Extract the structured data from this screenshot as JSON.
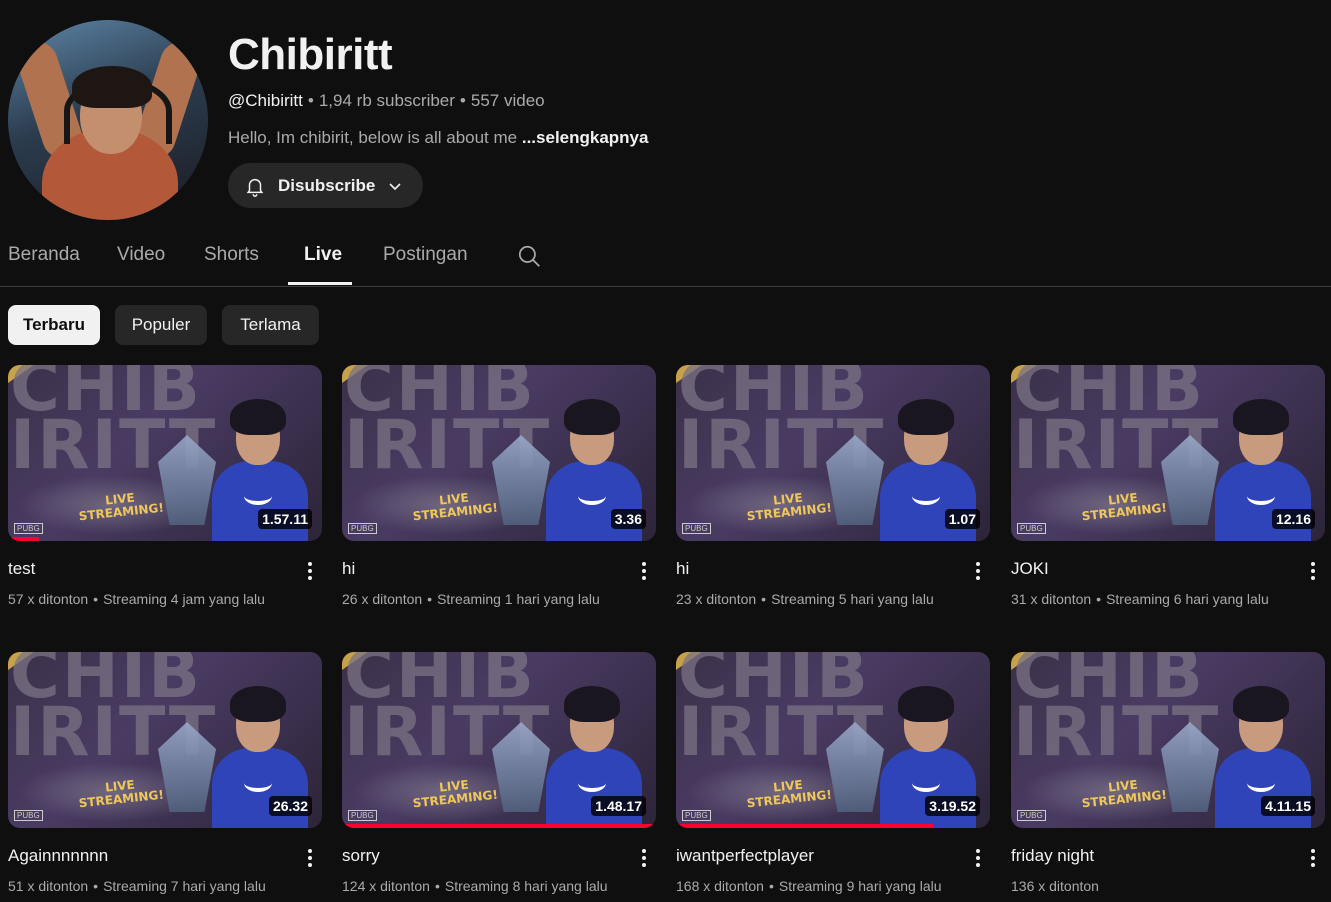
{
  "channel": {
    "name": "Chibiritt",
    "handle": "@Chibiritt",
    "subscribers": "1,94 rb subscriber",
    "video_count": "557 video",
    "description": "Hello, Im chibirit, below is all about me",
    "more_label": "...selengkapnya",
    "subscribe_label": "Disubscribe"
  },
  "tabs": [
    {
      "label": "Beranda",
      "active": false
    },
    {
      "label": "Video",
      "active": false
    },
    {
      "label": "Shorts",
      "active": false
    },
    {
      "label": "Live",
      "active": true
    },
    {
      "label": "Postingan",
      "active": false
    }
  ],
  "chips": [
    {
      "label": "Terbaru",
      "active": true
    },
    {
      "label": "Populer",
      "active": false
    },
    {
      "label": "Terlama",
      "active": false
    }
  ],
  "thumbnail_text": {
    "big": "CHIB IRITT",
    "live": "LIVE STREAMING!",
    "corner": "PUBG"
  },
  "videos": [
    {
      "title": "test",
      "views": "57 x ditonton",
      "time": "Streaming 4 jam yang lalu",
      "duration": "1.57.11",
      "watched": 0.1
    },
    {
      "title": "hi",
      "views": "26 x ditonton",
      "time": "Streaming 1 hari yang lalu",
      "duration": "3.36",
      "watched": 0
    },
    {
      "title": "hi",
      "views": "23 x ditonton",
      "time": "Streaming 5 hari yang lalu",
      "duration": "1.07",
      "watched": 0
    },
    {
      "title": "JOKI",
      "views": "31 x ditonton",
      "time": "Streaming 6 hari yang lalu",
      "duration": "12.16",
      "watched": 0
    },
    {
      "title": "Againnnnnnn",
      "views": "51 x ditonton",
      "time": "Streaming 7 hari yang lalu",
      "duration": "26.32",
      "watched": 0
    },
    {
      "title": "sorry",
      "views": "124 x ditonton",
      "time": "Streaming 8 hari yang lalu",
      "duration": "1.48.17",
      "watched": 1.0
    },
    {
      "title": "iwantperfectplayer",
      "views": "168 x ditonton",
      "time": "Streaming 9 hari yang lalu",
      "duration": "3.19.52",
      "watched": 0.82
    },
    {
      "title": "friday night",
      "views": "136 x ditonton",
      "time": "",
      "duration": "4.11.15",
      "watched": 0
    }
  ],
  "colors": {
    "background": "#0f0f0f",
    "progress": "#ff0033",
    "chip": "#272727"
  },
  "icons": [
    "bell-icon",
    "chevron-down-icon",
    "search-icon",
    "more-vert-icon"
  ]
}
